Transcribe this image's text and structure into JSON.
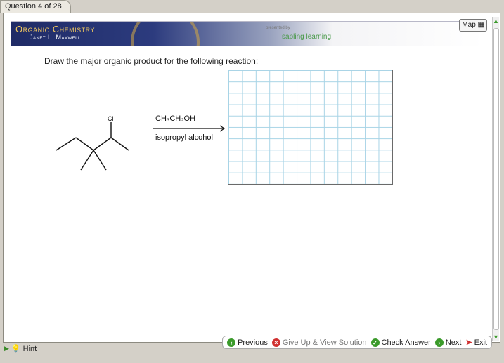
{
  "tab": {
    "label": "Question 4 of 28"
  },
  "banner": {
    "title": "Organic Chemistry",
    "author": "Janet L. Maxwell",
    "presented_by": "presented by",
    "sapling": "sapling learning"
  },
  "map": {
    "label": "Map"
  },
  "question": {
    "text": "Draw the major organic product for the following reaction:"
  },
  "reaction": {
    "substituent": "Cl",
    "reagent_top": "CH₃CH₂OH",
    "reagent_bottom": "isopropyl alcohol"
  },
  "hint": {
    "label": "Hint"
  },
  "nav": {
    "previous": "Previous",
    "give_up": "Give Up & View Solution",
    "check": "Check Answer",
    "next": "Next",
    "exit": "Exit"
  },
  "colors": {
    "green": "#3a9a2a",
    "red": "#d03030",
    "banner": "#1f2b66"
  }
}
